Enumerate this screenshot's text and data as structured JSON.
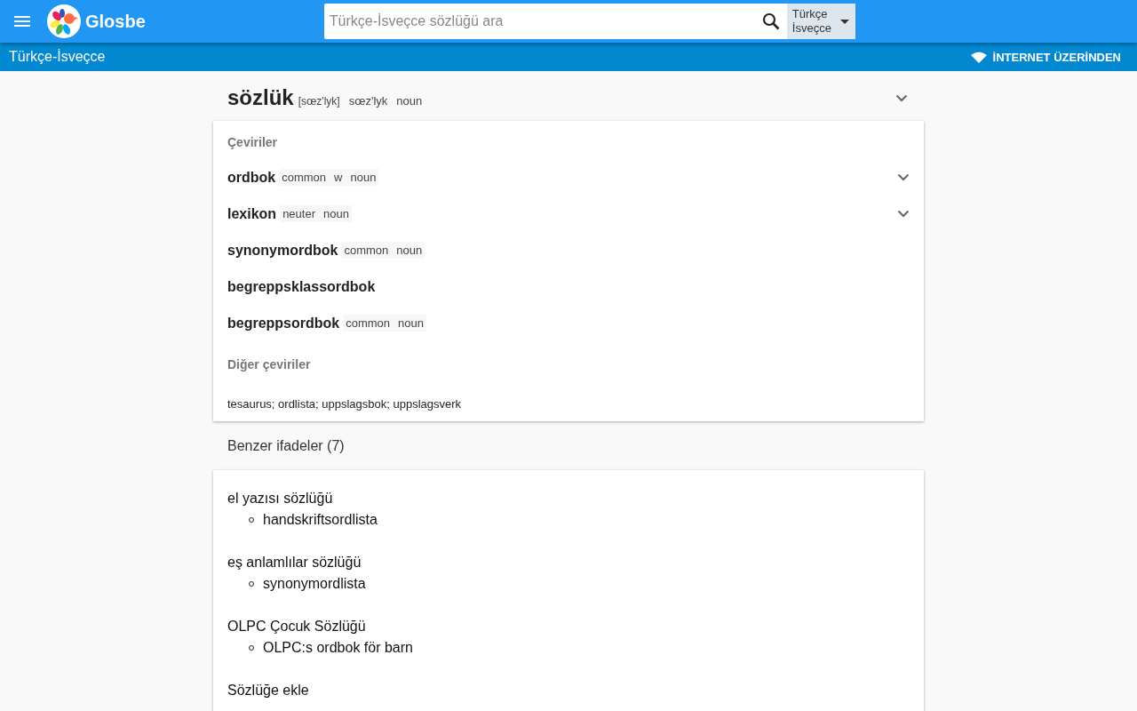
{
  "header": {
    "brand": "Glosbe",
    "search": {
      "placeholder": "Türkçe-İsveçce sözlüğü ara"
    },
    "language_button": {
      "line_1": "Türkçe",
      "line_2": "İsveçce"
    }
  },
  "sub_bar": {
    "title": "Türkçe-İsveçce",
    "mode": "İNTERNET ÜZERİNDEN"
  },
  "entry": {
    "word": "sözlük",
    "phonetic": "[sœz'lyk]",
    "pronunciation": "sœz'lyk",
    "part_of_speech": "noun",
    "expanded": false
  },
  "translations": {
    "heading": "Çeviriler",
    "items": [
      {
        "word": "ordbok",
        "tags": [
          "common",
          "w",
          "noun"
        ],
        "expandable": true
      },
      {
        "word": "lexikon",
        "tags": [
          "neuter",
          "noun"
        ],
        "expandable": true
      },
      {
        "word": "synonymordbok",
        "tags": [
          "common",
          "noun"
        ],
        "expandable": false
      },
      {
        "word": "begreppsklassordbok",
        "expandable": false
      },
      {
        "word": "begreppsordbok",
        "tags": [
          "common",
          "noun"
        ],
        "expandable": false
      }
    ],
    "other_heading": "Diğer çeviriler",
    "other": "tesaurus; ordlista; uppslagsbok; uppslagsverk"
  },
  "similar": {
    "heading": "Benzer ifadeler (7)",
    "items": [
      {
        "phrase": "el yazısı sözlüğü",
        "translations": [
          "handskriftsordlista"
        ]
      },
      {
        "phrase": "eş anlamlılar sözlüğü",
        "translations": [
          "synonymordlista"
        ]
      },
      {
        "phrase": "OLPC Çocuk Sözlüğü",
        "translations": [
          "OLPC:s ordbok för barn"
        ]
      },
      {
        "phrase": "Sözlüğe ekle"
      }
    ]
  }
}
